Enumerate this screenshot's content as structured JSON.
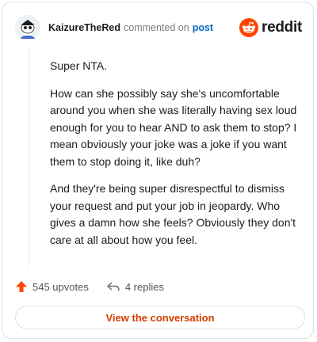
{
  "header": {
    "username": "KaizureTheRed",
    "action_text": "commented on",
    "link_text": "post",
    "brand": "reddit"
  },
  "comment": {
    "paragraphs": [
      "Super NTA.",
      "How can she possibly say she's uncomfortable around you when she was literally having sex loud enough for you to hear AND to ask them to stop? I mean obviously your joke was a joke if you want them to stop doing it, like duh?",
      "And they're being super disrespectful to dismiss your request and put your job in jeopardy. Who gives a damn how she feels? Obviously they don't care at all about how you feel."
    ]
  },
  "actions": {
    "upvotes": "545 upvotes",
    "replies": "4 replies"
  },
  "footer": {
    "view_button": "View the conversation"
  },
  "colors": {
    "upvote": "#ff4500",
    "link": "#0a66c2",
    "button_text": "#d63c00"
  },
  "icons": {
    "avatar": "snoo-avatar-icon",
    "brand": "reddit-logo-icon",
    "upvote": "upvote-arrow-icon",
    "reply": "reply-arrow-icon"
  }
}
